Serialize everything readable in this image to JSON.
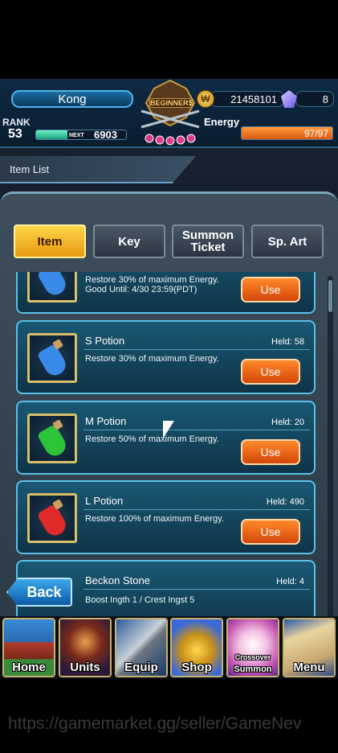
{
  "header": {
    "player_name": "Kong",
    "rank_label": "RANK",
    "rank_value": "53",
    "next_label": "NEXT",
    "next_value": "6903",
    "exp_fraction": 0.35,
    "emblem_text": "BEGINNERS",
    "gold_value": "21458101",
    "gem_value": "8",
    "energy_label": "Energy",
    "energy_value": "97/97",
    "energy_fraction": 1.0
  },
  "screen_title": "Item List",
  "tabs": [
    {
      "label": "Item",
      "active": true
    },
    {
      "label": "Key",
      "active": false
    },
    {
      "label": "Summon Ticket",
      "active": false
    },
    {
      "label": "Sp. Art",
      "active": false
    }
  ],
  "items": [
    {
      "name": "",
      "held": "",
      "desc": "Restore 30% of maximum Energy. Good Until: 4/30 23:59(PDT)",
      "use_label": "Use",
      "potion_color": "#3a8ae8"
    },
    {
      "name": "S Potion",
      "held": "Held: 58",
      "desc": "Restore 30% of maximum Energy.",
      "use_label": "Use",
      "potion_color": "#3a8ae8"
    },
    {
      "name": "M Potion",
      "held": "Held: 20",
      "desc": "Restore 50% of maximum Energy.",
      "use_label": "Use",
      "potion_color": "#2ec43a"
    },
    {
      "name": "L Potion",
      "held": "Held: 490",
      "desc": "Restore 100% of maximum Energy.",
      "use_label": "Use",
      "potion_color": "#e02a2a"
    },
    {
      "name": "Beckon Stone",
      "held": "Held: 4",
      "desc": "Boost Ingth 1 / Crest Ingst 5",
      "use_label": "",
      "potion_color": "#9aa0a8"
    }
  ],
  "back_label": "Back",
  "nav": [
    {
      "label": "Home",
      "icon": "home-icon"
    },
    {
      "label": "Units",
      "icon": "units-icon"
    },
    {
      "label": "Equip",
      "icon": "equip-icon"
    },
    {
      "label": "Shop",
      "icon": "shop-icon"
    },
    {
      "label": "Summon",
      "sublabel": "Crossover",
      "icon": "summon-icon"
    },
    {
      "label": "Menu",
      "icon": "menu-icon"
    }
  ],
  "watermark": "https://gamemarket.gg/seller/GameNev"
}
